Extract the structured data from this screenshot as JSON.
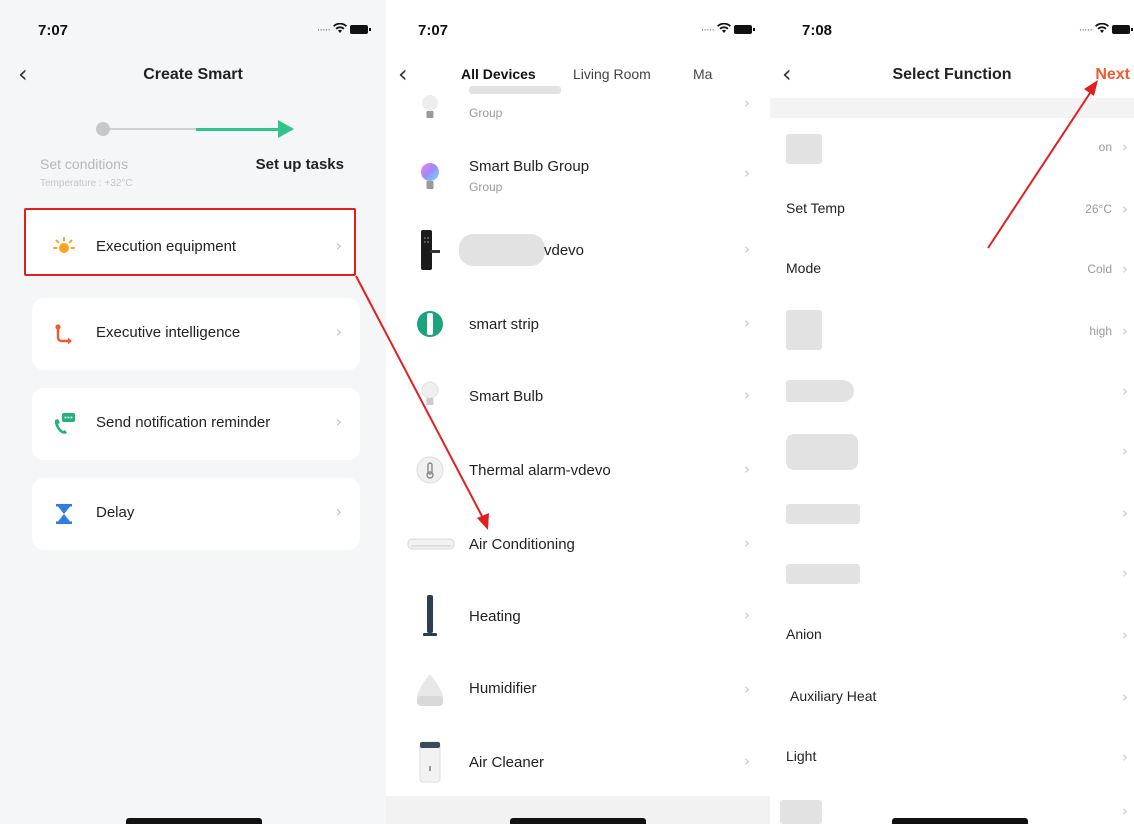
{
  "screen1": {
    "time": "7:07",
    "title": "Create Smart",
    "step_left": "Set conditions",
    "step_left_sub": "Temperature : +32°C",
    "step_right": "Set up tasks",
    "cards": [
      {
        "label": "Execution equipment",
        "icon": "sun-icon"
      },
      {
        "label": "Executive intelligence",
        "icon": "branch-icon"
      },
      {
        "label": "Send notification reminder",
        "icon": "phone-message-icon"
      },
      {
        "label": "Delay",
        "icon": "hourglass-icon"
      }
    ],
    "colors": {
      "accent_green": "#2ec48a",
      "highlight_red": "#e02020"
    }
  },
  "screen2": {
    "time": "7:07",
    "tabs": [
      "All Devices",
      "Living Room",
      "Ma"
    ],
    "devices": [
      {
        "name": "",
        "sub": "Group",
        "icon": "bulb-icon"
      },
      {
        "name": "Smart Bulb Group",
        "sub": "Group",
        "icon": "color-bulb-icon"
      },
      {
        "name": "vdevo",
        "sub": "",
        "icon": "door-lock-icon"
      },
      {
        "name": "smart strip",
        "sub": "",
        "icon": "strip-icon"
      },
      {
        "name": "Smart Bulb",
        "sub": "",
        "icon": "bulb-icon"
      },
      {
        "name": "Thermal alarm-vdevo",
        "sub": "",
        "icon": "thermometer-icon"
      },
      {
        "name": "Air Conditioning",
        "sub": "",
        "icon": "air-conditioner-icon"
      },
      {
        "name": "Heating",
        "sub": "",
        "icon": "heater-icon"
      },
      {
        "name": "Humidifier",
        "sub": "",
        "icon": "humidifier-icon"
      },
      {
        "name": "Air Cleaner",
        "sub": "",
        "icon": "air-purifier-icon"
      }
    ]
  },
  "screen3": {
    "time": "7:08",
    "title": "Select Function",
    "next": "Next",
    "functions": [
      {
        "label": "",
        "value": "on"
      },
      {
        "label": "Set Temp",
        "value": "26°C"
      },
      {
        "label": "Mode",
        "value": "Cold"
      },
      {
        "label": "",
        "value": "high"
      },
      {
        "label": "",
        "value": ""
      },
      {
        "label": "",
        "value": ""
      },
      {
        "label": "",
        "value": ""
      },
      {
        "label": "",
        "value": ""
      },
      {
        "label": "Anion",
        "value": ""
      },
      {
        "label": "Auxiliary Heat",
        "value": ""
      },
      {
        "label": "Light",
        "value": ""
      },
      {
        "label": "",
        "value": ""
      }
    ],
    "colors": {
      "next_orange": "#f25a2e"
    }
  }
}
